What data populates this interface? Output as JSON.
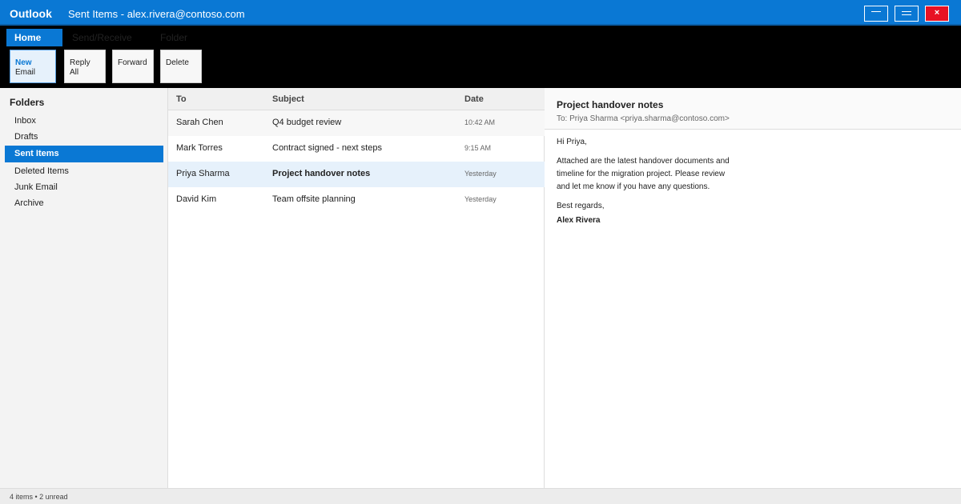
{
  "titlebar": {
    "app_name": "Outlook",
    "window_title": "Sent Items - alex.rivera@contoso.com",
    "close_glyph": "×"
  },
  "ribbon": {
    "tabs": [
      {
        "label": "Home",
        "active": true
      },
      {
        "label": "Send/Receive",
        "active": false
      },
      {
        "label": "Folder",
        "active": false
      }
    ],
    "buttons": [
      {
        "line1": "New",
        "line2": "Email"
      },
      {
        "line1": "Reply",
        "line2": "All"
      },
      {
        "line1": "Forward",
        "line2": ""
      },
      {
        "line1": "Delete",
        "line2": ""
      }
    ]
  },
  "folders": {
    "title": "Folders",
    "items": [
      {
        "label": "Inbox",
        "selected": false
      },
      {
        "label": "Drafts",
        "selected": false
      },
      {
        "label": "Sent Items",
        "selected": true
      },
      {
        "label": "Deleted Items",
        "selected": false
      },
      {
        "label": "Junk Email",
        "selected": false
      },
      {
        "label": "Archive",
        "selected": false
      }
    ]
  },
  "message_list": {
    "columns": [
      "To",
      "Subject",
      "Date"
    ],
    "rows": [
      {
        "to": "Sarah Chen",
        "subject": "Q4 budget review",
        "date": "10:42 AM"
      },
      {
        "to": "Mark Torres",
        "subject": "Contract signed - next steps",
        "date": "9:15 AM"
      },
      {
        "to": "Priya Sharma",
        "subject": "Project handover notes",
        "date": "Yesterday"
      },
      {
        "to": "David Kim",
        "subject": "Team offsite planning",
        "date": "Yesterday"
      }
    ],
    "selected_index": 2
  },
  "reading_pane": {
    "subject": "Project handover notes",
    "to_line": "To: Priya Sharma <priya.sharma@contoso.com>",
    "body": {
      "greeting": "Hi Priya,",
      "lines": [
        "Attached are the latest handover documents and",
        "timeline for the migration project. Please review",
        "and let me know if you have any questions."
      ],
      "closing": "Best regards,",
      "signature": "Alex Rivera"
    }
  },
  "status_bar": {
    "text": "4 items • 2 unread"
  },
  "colors": {
    "accent": "#0a78d4",
    "close": "#e81123",
    "ribbon_bg": "#000000",
    "selected_row": "#e6f1fb"
  }
}
